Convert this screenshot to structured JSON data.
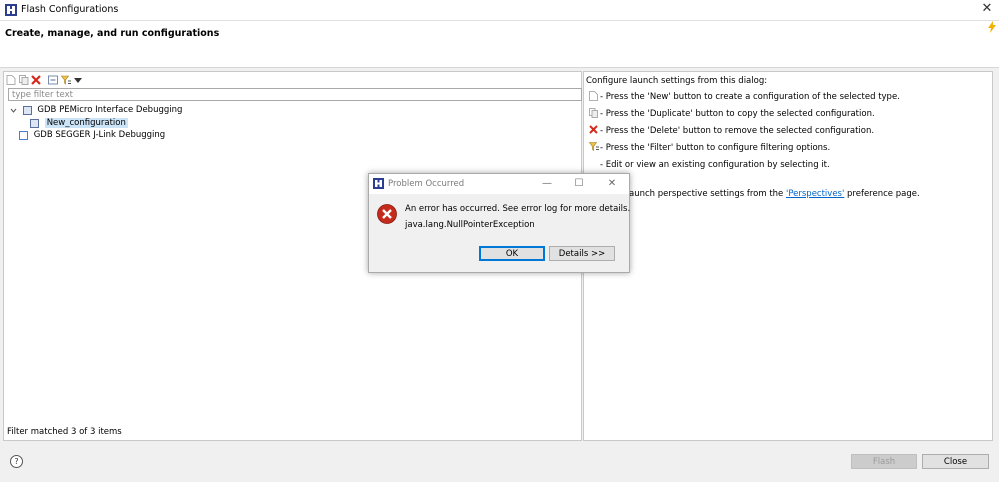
{
  "window": {
    "title": "Flash Configurations",
    "close_glyph": "✕"
  },
  "header": {
    "title": "Create, manage, and run configurations"
  },
  "left": {
    "toolbar": [
      "new-config-icon",
      "duplicate-config-icon",
      "delete-config-icon",
      "collapse-all-icon",
      "filter-icon",
      "view-menu-icon"
    ],
    "filter_placeholder": "type filter text",
    "tree": {
      "items": [
        {
          "label": "GDB PEMicro Interface Debugging",
          "expanded": true,
          "children": [
            {
              "label": "New_configuration",
              "selected": true
            }
          ]
        },
        {
          "label": "GDB SEGGER J-Link Debugging",
          "expanded": false
        }
      ]
    },
    "status": "Filter matched 3 of 3 items"
  },
  "right": {
    "intro": "Configure launch settings from this dialog:",
    "lines": [
      {
        "icon": "new-icon",
        "text": "- Press the 'New' button to create a configuration of the selected type."
      },
      {
        "icon": "duplicate-icon",
        "text": "- Press the 'Duplicate' button to copy the selected configuration."
      },
      {
        "icon": "delete-icon",
        "text": "- Press the 'Delete' button to remove the selected configuration."
      },
      {
        "icon": "filter-icon",
        "text": "- Press the 'Filter' button to configure filtering options."
      },
      {
        "icon": "",
        "text": "- Edit or view an existing configuration by selecting it."
      }
    ],
    "perspective_prefix": "aunch perspective settings from the ",
    "perspective_link": "'Perspectives'",
    "perspective_suffix": " preference page."
  },
  "footer": {
    "help_glyph": "?",
    "flash_label": "Flash",
    "close_label": "Close"
  },
  "dialog": {
    "title": "Problem Occurred",
    "message": "An error has occurred. See error log for more details.",
    "detail": "java.lang.NullPointerException",
    "ok_label": "OK",
    "details_label": "Details >>",
    "minimize_glyph": "—",
    "maximize_glyph": "☐",
    "close_glyph": "✕"
  },
  "colors": {
    "accent": "#0078d7",
    "error": "#c42b1c",
    "selection": "#cce4f7",
    "link": "#0066cc"
  }
}
